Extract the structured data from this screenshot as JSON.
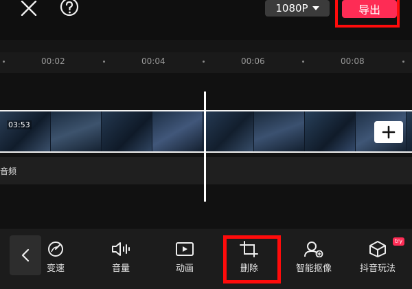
{
  "header": {
    "close_icon": "close-icon",
    "help_icon": "help-icon",
    "resolution": "1080P",
    "export_label": "导出",
    "export_color": "#fe2c55"
  },
  "timeline": {
    "ticks": [
      "00:02",
      "00:04",
      "00:06",
      "00:08"
    ],
    "video_duration": "03:53",
    "audio_label": "音频",
    "add_icon": "plus-icon"
  },
  "toolbar": {
    "tools": [
      {
        "label": "变速",
        "icon": "speed-icon"
      },
      {
        "label": "音量",
        "icon": "volume-icon"
      },
      {
        "label": "动画",
        "icon": "animation-icon"
      },
      {
        "label": "删除",
        "icon": "delete-crop-icon"
      },
      {
        "label": "智能抠像",
        "icon": "smart-cutout-icon"
      },
      {
        "label": "抖音玩法",
        "icon": "cube-icon",
        "badge": "try"
      }
    ]
  },
  "highlight_color": "#ff0b0b"
}
